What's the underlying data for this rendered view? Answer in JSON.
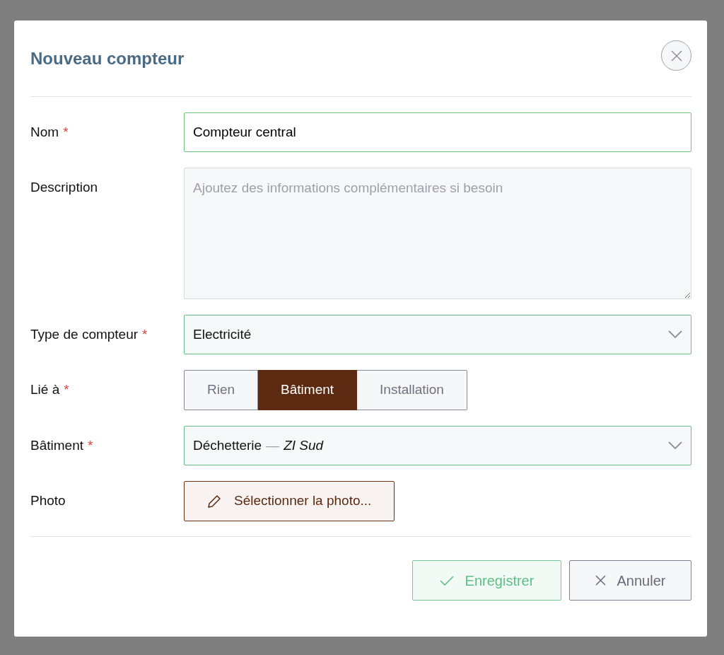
{
  "dialog": {
    "title": "Nouveau compteur"
  },
  "required_marker": "*",
  "fields": [
    {
      "kind": "text",
      "label": "Nom",
      "required": true,
      "value": "Compteur central"
    },
    {
      "kind": "textarea",
      "label": "Description",
      "required": false,
      "placeholder": "Ajoutez des informations complémentaires si besoin"
    },
    {
      "kind": "select",
      "label": "Type de compteur",
      "required": true,
      "value": "Electricité"
    },
    {
      "kind": "segmented",
      "label": "Lié à",
      "required": true,
      "options": [
        {
          "label": "Rien",
          "selected": false
        },
        {
          "label": "Bâtiment",
          "selected": true
        },
        {
          "label": "Installation",
          "selected": false
        }
      ]
    },
    {
      "kind": "select",
      "label": "Bâtiment",
      "required": true,
      "value": "Déchetterie",
      "separator": "—",
      "detail": "ZI Sud"
    },
    {
      "kind": "file",
      "label": "Photo",
      "required": false,
      "button": "Sélectionner la photo..."
    }
  ],
  "buttons": [
    {
      "kind": "save",
      "label": "Enregistrer"
    },
    {
      "kind": "cancel",
      "label": "Annuler"
    }
  ]
}
